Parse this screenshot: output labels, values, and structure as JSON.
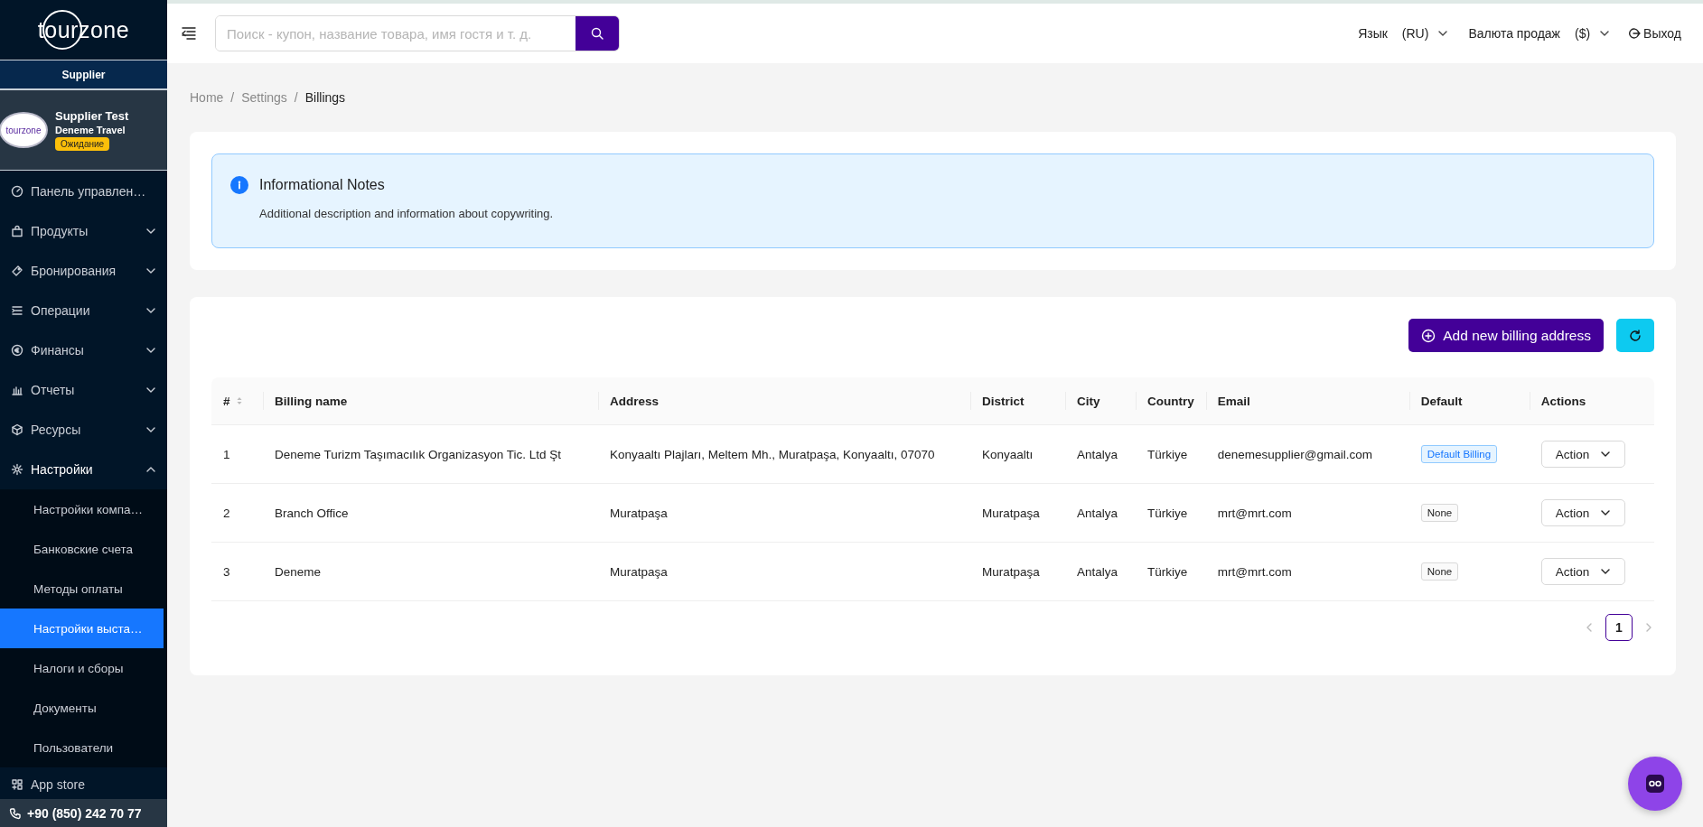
{
  "sidebar": {
    "logo": "tourzone",
    "role": "Supplier",
    "profile": {
      "avatar_logo": "tourzone",
      "name": "Supplier Test",
      "company": "Deneme Travel",
      "status": "Ожидание"
    },
    "menu": [
      {
        "kind": "link",
        "label": "Панель управлен…"
      },
      {
        "kind": "group",
        "label": "Продукты",
        "expanded": false
      },
      {
        "kind": "group",
        "label": "Бронирования",
        "expanded": false
      },
      {
        "kind": "group",
        "label": "Операции",
        "expanded": false
      },
      {
        "kind": "group",
        "label": "Финансы",
        "expanded": false
      },
      {
        "kind": "group",
        "label": "Отчеты",
        "expanded": false
      },
      {
        "kind": "group",
        "label": "Ресурсы",
        "expanded": false
      },
      {
        "kind": "group",
        "label": "Настройки",
        "expanded": true,
        "children": [
          {
            "label": "Настройки компа…",
            "selected": false
          },
          {
            "label": "Банковские счета",
            "selected": false
          },
          {
            "label": "Методы оплаты",
            "selected": false
          },
          {
            "label": "Настройки выста…",
            "selected": true
          },
          {
            "label": "Налоги и сборы",
            "selected": false
          },
          {
            "label": "Документы",
            "selected": false
          },
          {
            "label": "Пользователи",
            "selected": false
          }
        ]
      },
      {
        "kind": "link",
        "label": "App store"
      }
    ],
    "phone": "+90 (850) 242 70 77"
  },
  "topbar": {
    "search": {
      "placeholder": "Поиск - купон, название товара, имя гостя и т. д."
    },
    "language_label": "Язык",
    "language_value": "(RU)",
    "currency_label": "Валюта продаж",
    "currency_value": "($)",
    "logout": "Выход"
  },
  "breadcrumb": {
    "separator": "/",
    "items": [
      "Home",
      "Settings",
      "Billings"
    ]
  },
  "info_note": {
    "title": "Informational Notes",
    "text": "Additional description and information about copywriting."
  },
  "billing": {
    "add_button": "Add new billing address",
    "columns": [
      {
        "label": "#",
        "sortable": true
      },
      {
        "label": "Billing name",
        "sortable": false
      },
      {
        "label": "Address",
        "sortable": false
      },
      {
        "label": "District",
        "sortable": false
      },
      {
        "label": "City",
        "sortable": false
      },
      {
        "label": "Country",
        "sortable": false
      },
      {
        "label": "Email",
        "sortable": false
      },
      {
        "label": "Default",
        "sortable": false
      },
      {
        "label": "Actions",
        "sortable": false
      }
    ],
    "rows": [
      {
        "no": "1",
        "name": "Deneme Turizm Taşımacılık Organizasyon Tic. Ltd Şt",
        "address": "Konyaaltı Plajları, Meltem Mh., Muratpaşa, Konyaaltı, 07070",
        "district": "Konyaaltı",
        "city": "Antalya",
        "country": "Türkiye",
        "email": "denemesupplier@gmail.com",
        "default": {
          "label": "Default Billing",
          "is_default": true
        },
        "action": "Action"
      },
      {
        "no": "2",
        "name": "Branch Office",
        "address": "Muratpaşa",
        "district": "Muratpaşa",
        "city": "Antalya",
        "country": "Türkiye",
        "email": "mrt@mrt.com",
        "default": {
          "label": "None",
          "is_default": false
        },
        "action": "Action"
      },
      {
        "no": "3",
        "name": "Deneme",
        "address": "Muratpaşa",
        "district": "Muratpaşa",
        "city": "Antalya",
        "country": "Türkiye",
        "email": "mrt@mrt.com",
        "default": {
          "label": "None",
          "is_default": false
        },
        "action": "Action"
      }
    ],
    "pagination": {
      "pages": [
        {
          "label": "1",
          "selected": true
        }
      ]
    }
  }
}
